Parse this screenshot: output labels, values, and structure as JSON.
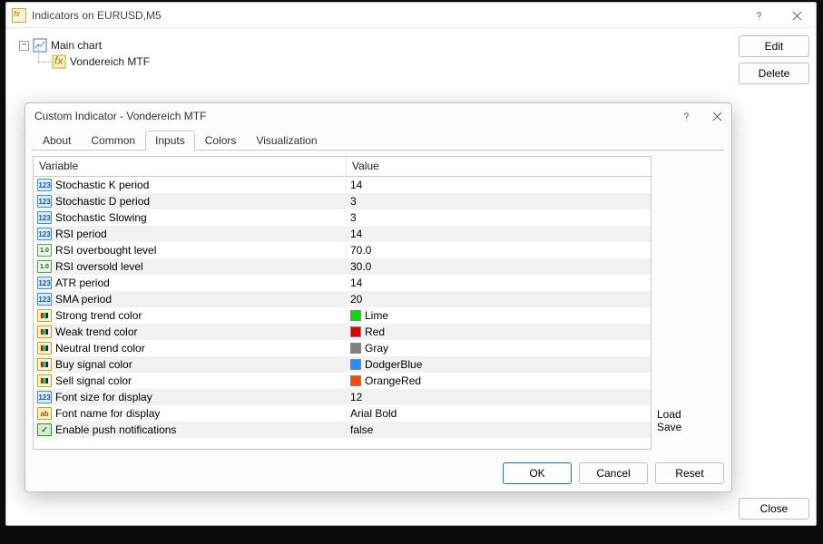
{
  "outer": {
    "title": "Indicators on EURUSD,M5",
    "tree": {
      "main": "Main chart",
      "child": "Vondereich MTF"
    },
    "edit": "Edit",
    "delete": "Delete",
    "close": "Close"
  },
  "dialog": {
    "title": "Custom Indicator - Vondereich MTF",
    "tabs": {
      "about": "About",
      "common": "Common",
      "inputs": "Inputs",
      "colors": "Colors",
      "visualization": "Visualization"
    },
    "headers": {
      "variable": "Variable",
      "value": "Value"
    },
    "params": [
      {
        "type": "int",
        "name": "Stochastic K period",
        "value": "14"
      },
      {
        "type": "int",
        "name": "Stochastic D period",
        "value": "3"
      },
      {
        "type": "int",
        "name": "Stochastic Slowing",
        "value": "3"
      },
      {
        "type": "int",
        "name": "RSI period",
        "value": "14"
      },
      {
        "type": "flt",
        "name": "RSI overbought level",
        "value": "70.0"
      },
      {
        "type": "flt",
        "name": "RSI oversold level",
        "value": "30.0"
      },
      {
        "type": "int",
        "name": "ATR period",
        "value": "14"
      },
      {
        "type": "int",
        "name": "SMA period",
        "value": "20"
      },
      {
        "type": "clr",
        "name": "Strong trend color",
        "value": "Lime",
        "swatch": "#00e000"
      },
      {
        "type": "clr",
        "name": "Weak trend color",
        "value": "Red",
        "swatch": "#e00000"
      },
      {
        "type": "clr",
        "name": "Neutral trend color",
        "value": "Gray",
        "swatch": "#808080"
      },
      {
        "type": "clr",
        "name": "Buy signal color",
        "value": "DodgerBlue",
        "swatch": "#1e90ff"
      },
      {
        "type": "clr",
        "name": "Sell signal color",
        "value": "OrangeRed",
        "swatch": "#ff4500"
      },
      {
        "type": "int",
        "name": "Font size for display",
        "value": "12"
      },
      {
        "type": "str",
        "name": "Font name for display",
        "value": "Arial Bold"
      },
      {
        "type": "bool",
        "name": "Enable push notifications",
        "value": "false"
      }
    ],
    "load": "Load",
    "save": "Save",
    "ok": "OK",
    "cancel": "Cancel",
    "reset": "Reset"
  }
}
